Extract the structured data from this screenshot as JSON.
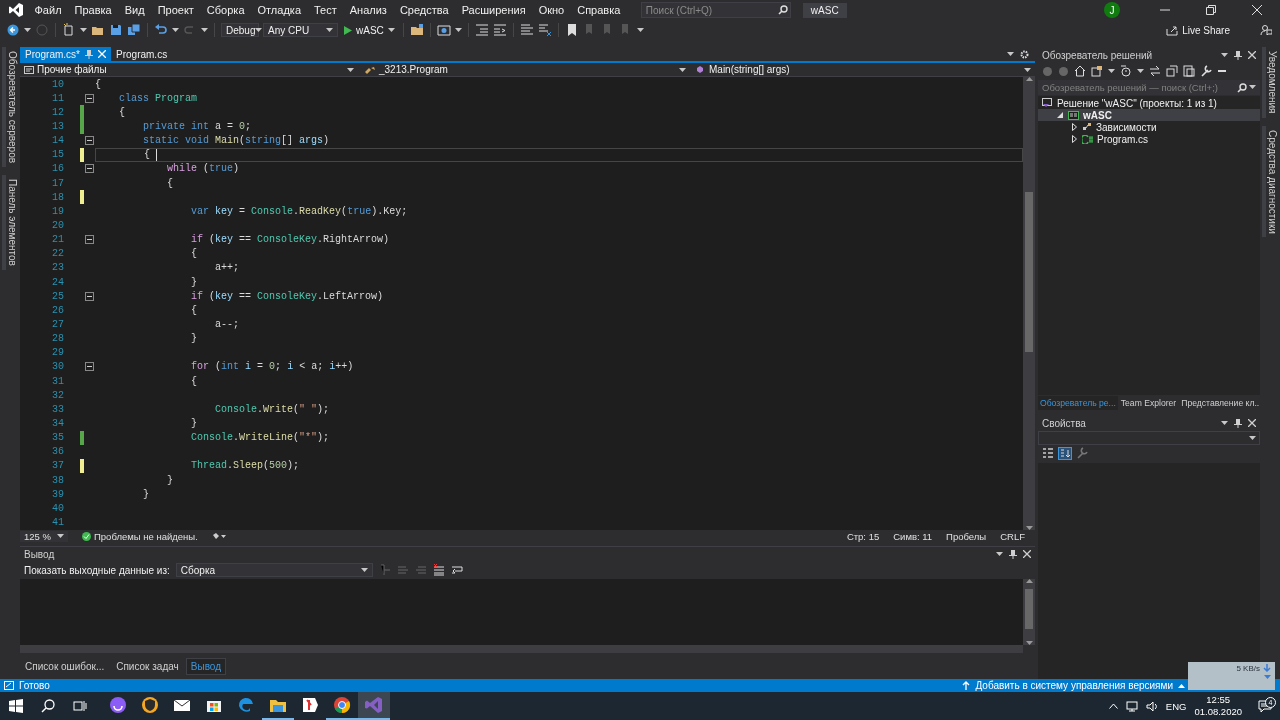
{
  "menu": [
    "Файл",
    "Правка",
    "Вид",
    "Проект",
    "Сборка",
    "Отладка",
    "Тест",
    "Анализ",
    "Средства",
    "Расширения",
    "Окно",
    "Справка"
  ],
  "search": {
    "placeholder": "Поиск (Ctrl+Q)"
  },
  "solution_name": "wASC",
  "account_initial": "J",
  "toolbar": {
    "configuration": "Debug",
    "platform": "Any CPU",
    "start": "wASC",
    "live_share": "Live Share"
  },
  "left_strip": [
    "Обозреватель серверов",
    "Панель элементов"
  ],
  "right_strip": [
    "Уведомления",
    "Средства диагностики"
  ],
  "editor": {
    "tabs": [
      {
        "label": "Program.cs*",
        "selected": true
      },
      {
        "label": "Program.cs",
        "selected": false
      }
    ],
    "nav": {
      "project": "Прочие файлы",
      "type": "_3213.Program",
      "member": "Main(string[] args)"
    },
    "lines": [
      {
        "number": "10",
        "fold": false,
        "current": false,
        "tokens": [
          {
            "kind": "plain",
            "text": "{"
          }
        ]
      },
      {
        "number": "11",
        "fold": true,
        "current": false,
        "tokens": [
          {
            "kind": "keyword",
            "text": "    class"
          },
          {
            "kind": "type",
            "text": " Program"
          }
        ]
      },
      {
        "number": "12",
        "fold": false,
        "current": false,
        "color": "#57a64a",
        "tokens": [
          {
            "kind": "plain",
            "text": "    {"
          }
        ]
      },
      {
        "number": "13",
        "fold": false,
        "current": false,
        "color": "#57a64a",
        "tokens": [
          {
            "kind": "keyword",
            "text": "        private"
          },
          {
            "kind": "keyword",
            "text": " int"
          },
          {
            "kind": "plain",
            "text": " a = "
          },
          {
            "kind": "number",
            "text": "0"
          },
          {
            "kind": "plain",
            "text": ";"
          }
        ]
      },
      {
        "number": "14",
        "fold": true,
        "current": false,
        "tokens": [
          {
            "kind": "keyword",
            "text": "        static"
          },
          {
            "kind": "keyword",
            "text": " void"
          },
          {
            "kind": "method",
            "text": " Main"
          },
          {
            "kind": "plain",
            "text": "("
          },
          {
            "kind": "keyword",
            "text": "string"
          },
          {
            "kind": "plain",
            "text": "[] "
          },
          {
            "kind": "variable",
            "text": "args"
          },
          {
            "kind": "plain",
            "text": ")"
          }
        ]
      },
      {
        "number": "15",
        "fold": false,
        "current": true,
        "color": "#efef91",
        "tokens": [
          {
            "kind": "plain",
            "text": "        { "
          }
        ]
      },
      {
        "number": "16",
        "fold": true,
        "current": false,
        "tokens": [
          {
            "kind": "control",
            "text": "            while"
          },
          {
            "kind": "plain",
            "text": " ("
          },
          {
            "kind": "keyword",
            "text": "true"
          },
          {
            "kind": "plain",
            "text": ")"
          }
        ]
      },
      {
        "number": "17",
        "fold": false,
        "current": false,
        "tokens": [
          {
            "kind": "plain",
            "text": "            {"
          }
        ]
      },
      {
        "number": "18",
        "fold": false,
        "current": false,
        "color": "#efef91"
      },
      {
        "number": "19",
        "fold": false,
        "current": false,
        "tokens": [
          {
            "kind": "keyword",
            "text": "                var"
          },
          {
            "kind": "variable",
            "text": " key"
          },
          {
            "kind": "plain",
            "text": " = "
          },
          {
            "kind": "type",
            "text": "Console"
          },
          {
            "kind": "plain",
            "text": "."
          },
          {
            "kind": "method",
            "text": "ReadKey"
          },
          {
            "kind": "plain",
            "text": "("
          },
          {
            "kind": "keyword",
            "text": "true"
          },
          {
            "kind": "plain",
            "text": ").Key;"
          }
        ]
      },
      {
        "number": "20",
        "fold": false,
        "current": false
      },
      {
        "number": "21",
        "fold": true,
        "current": false,
        "tokens": [
          {
            "kind": "control",
            "text": "                if"
          },
          {
            "kind": "plain",
            "text": " ("
          },
          {
            "kind": "variable",
            "text": "key"
          },
          {
            "kind": "plain",
            "text": " == "
          },
          {
            "kind": "type",
            "text": "ConsoleKey"
          },
          {
            "kind": "plain",
            "text": ".RightArrow)"
          }
        ]
      },
      {
        "number": "22",
        "fold": false,
        "current": false,
        "tokens": [
          {
            "kind": "plain",
            "text": "                {"
          }
        ]
      },
      {
        "number": "23",
        "fold": false,
        "current": false,
        "tokens": [
          {
            "kind": "plain",
            "text": "                    a++;"
          }
        ]
      },
      {
        "number": "24",
        "fold": false,
        "current": false,
        "tokens": [
          {
            "kind": "plain",
            "text": "                }"
          }
        ]
      },
      {
        "number": "25",
        "fold": true,
        "current": false,
        "tokens": [
          {
            "kind": "control",
            "text": "                if"
          },
          {
            "kind": "plain",
            "text": " ("
          },
          {
            "kind": "variable",
            "text": "key"
          },
          {
            "kind": "plain",
            "text": " == "
          },
          {
            "kind": "type",
            "text": "ConsoleKey"
          },
          {
            "kind": "plain",
            "text": ".LeftArrow)"
          }
        ]
      },
      {
        "number": "26",
        "fold": false,
        "current": false,
        "tokens": [
          {
            "kind": "plain",
            "text": "                {"
          }
        ]
      },
      {
        "number": "27",
        "fold": false,
        "current": false,
        "tokens": [
          {
            "kind": "plain",
            "text": "                    a--;"
          }
        ]
      },
      {
        "number": "28",
        "fold": false,
        "current": false,
        "tokens": [
          {
            "kind": "plain",
            "text": "                }"
          }
        ]
      },
      {
        "number": "29",
        "fold": false,
        "current": false
      },
      {
        "number": "30",
        "fold": true,
        "current": false,
        "tokens": [
          {
            "kind": "control",
            "text": "                for"
          },
          {
            "kind": "plain",
            "text": " ("
          },
          {
            "kind": "keyword",
            "text": "int"
          },
          {
            "kind": "variable",
            "text": " i"
          },
          {
            "kind": "plain",
            "text": " = "
          },
          {
            "kind": "number",
            "text": "0"
          },
          {
            "kind": "plain",
            "text": "; "
          },
          {
            "kind": "variable",
            "text": "i"
          },
          {
            "kind": "plain",
            "text": " < a; "
          },
          {
            "kind": "variable",
            "text": "i"
          },
          {
            "kind": "plain",
            "text": "++)"
          }
        ]
      },
      {
        "number": "31",
        "fold": false,
        "current": false,
        "tokens": [
          {
            "kind": "plain",
            "text": "                {"
          }
        ]
      },
      {
        "number": "32",
        "fold": false,
        "current": false
      },
      {
        "number": "33",
        "fold": false,
        "current": false,
        "tokens": [
          {
            "kind": "type",
            "text": "                    Console"
          },
          {
            "kind": "plain",
            "text": "."
          },
          {
            "kind": "method",
            "text": "Write"
          },
          {
            "kind": "plain",
            "text": "("
          },
          {
            "kind": "string",
            "text": "\" \""
          },
          {
            "kind": "plain",
            "text": ");"
          }
        ]
      },
      {
        "number": "34",
        "fold": false,
        "current": false,
        "tokens": [
          {
            "kind": "plain",
            "text": "                }"
          }
        ]
      },
      {
        "number": "35",
        "fold": false,
        "current": false,
        "color": "#57a64a",
        "tokens": [
          {
            "kind": "type",
            "text": "                Console"
          },
          {
            "kind": "plain",
            "text": "."
          },
          {
            "kind": "method",
            "text": "WriteLine"
          },
          {
            "kind": "plain",
            "text": "("
          },
          {
            "kind": "string",
            "text": "\"*\""
          },
          {
            "kind": "plain",
            "text": ");"
          }
        ]
      },
      {
        "number": "36",
        "fold": false,
        "current": false
      },
      {
        "number": "37",
        "fold": false,
        "current": false,
        "color": "#efef91",
        "tokens": [
          {
            "kind": "type",
            "text": "                Thread"
          },
          {
            "kind": "plain",
            "text": "."
          },
          {
            "kind": "method",
            "text": "Sleep"
          },
          {
            "kind": "plain",
            "text": "("
          },
          {
            "kind": "number",
            "text": "500"
          },
          {
            "kind": "plain",
            "text": ");"
          }
        ]
      },
      {
        "number": "38",
        "fold": false,
        "current": false,
        "tokens": [
          {
            "kind": "plain",
            "text": "            }"
          }
        ]
      },
      {
        "number": "39",
        "fold": false,
        "current": false,
        "tokens": [
          {
            "kind": "plain",
            "text": "        }"
          }
        ]
      },
      {
        "number": "40",
        "fold": false,
        "current": false
      },
      {
        "number": "41",
        "fold": false,
        "current": false
      }
    ],
    "status": {
      "zoom": "125 %",
      "issues": "Проблемы не найдены.",
      "line": "Стр: 15",
      "column": "Симв: 11",
      "indent": "Пробелы",
      "eol": "CRLF"
    }
  },
  "output": {
    "title": "Вывод",
    "source_label": "Показать выходные данные из:",
    "source": "Сборка",
    "tabs": [
      {
        "label": "Список ошибок...",
        "selected": false
      },
      {
        "label": "Список задач",
        "selected": false
      },
      {
        "label": "Вывод",
        "selected": true
      }
    ]
  },
  "solution_explorer": {
    "title": "Обозреватель решений",
    "search": {
      "placeholder": "Обозреватель решений — поиск (Ctrl+;)"
    },
    "tree": [
      {
        "label": "Решение \"wASC\" (проекты: 1 из 1)",
        "kind": "solution",
        "selected": false,
        "children": [
          {
            "label": "wASC",
            "kind": "project",
            "expanded": true,
            "selected": true,
            "children": [
              {
                "label": "Зависимости",
                "kind": "dependencies",
                "expanded": false,
                "selected": false
              },
              {
                "label": "Program.cs",
                "kind": "csharp",
                "expanded": false,
                "selected": false
              }
            ]
          }
        ]
      }
    ],
    "tabs": [
      {
        "label": "Обозреватель ре...",
        "selected": true
      },
      {
        "label": "Team Explorer",
        "selected": false
      },
      {
        "label": "Представление кл...",
        "selected": false
      }
    ]
  },
  "properties": {
    "title": "Свойства"
  },
  "status_bar": {
    "text": "Готово",
    "source_control": "Добавить в систему управления версиями"
  },
  "network_widget": {
    "speed": "5 KB/s"
  },
  "taskbar": {
    "apps": [
      {
        "kind": "assistant",
        "running": false,
        "selected": false
      },
      {
        "kind": "shield-browser",
        "running": false,
        "selected": false
      },
      {
        "kind": "mail",
        "running": false,
        "selected": false
      },
      {
        "kind": "store",
        "running": false,
        "selected": false
      },
      {
        "kind": "edge",
        "running": false,
        "selected": false
      },
      {
        "kind": "folder",
        "running": true,
        "selected": false
      },
      {
        "kind": "yandex",
        "running": false,
        "selected": false
      },
      {
        "kind": "chrome",
        "running": true,
        "selected": false
      },
      {
        "kind": "vs",
        "running": true,
        "selected": true
      }
    ],
    "language": "ENG",
    "time": "12:55",
    "date": "01.08.2020",
    "notifications": "4"
  }
}
